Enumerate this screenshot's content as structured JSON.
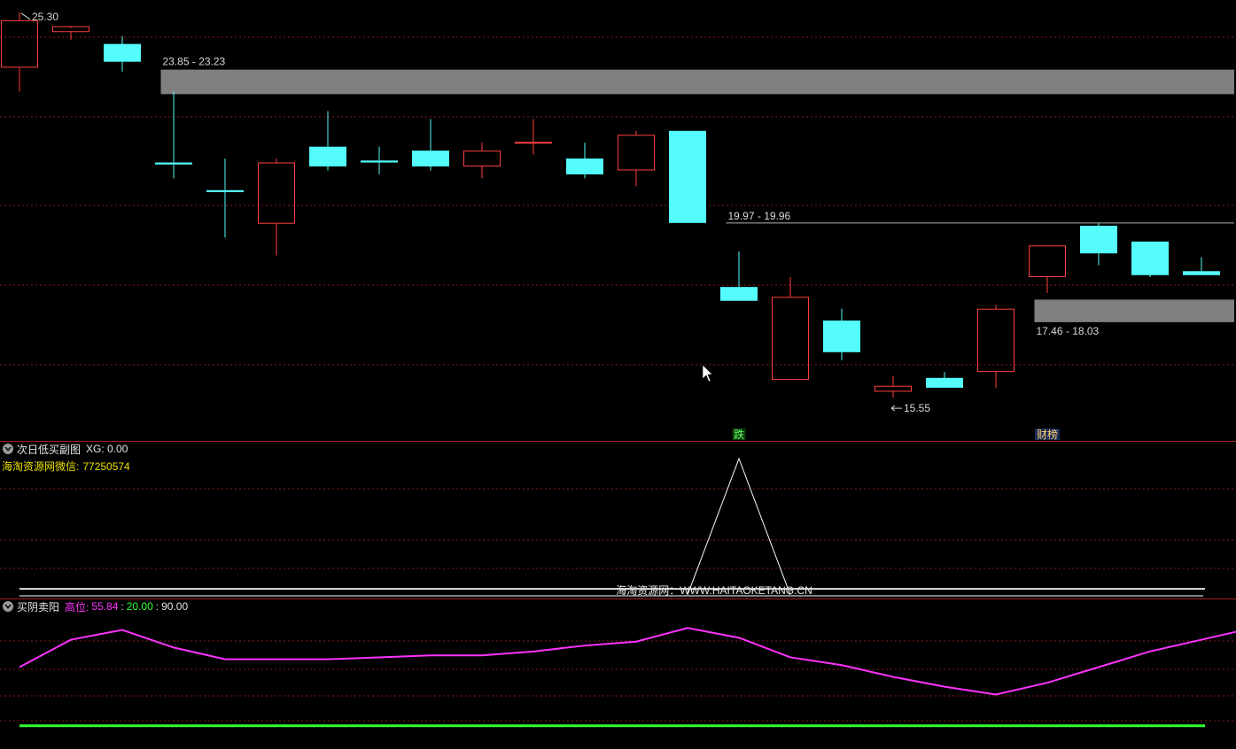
{
  "colors": {
    "up": "#ff4040",
    "down": "#54fcfc",
    "zone": "#808080",
    "grid": "#8b1a1a",
    "divider": "#a02020",
    "label": "#d8d8d8",
    "magenta": "#ff33ff",
    "green": "#33ff33",
    "signal": "#ffffff"
  },
  "pane1": {
    "title": "次日低买副图",
    "indicator": "XG",
    "value": "0.00",
    "wechat_label": "海淘资源网微信:",
    "wechat_id": "77250574",
    "watermark": "海淘资源网：WWW.HAITAOKETANG.CN"
  },
  "pane2": {
    "title": "买阴卖阳",
    "high_label": "高位:",
    "v1": "55.84",
    "v2": "20.00",
    "v3": "90.00"
  },
  "chart_data": [
    {
      "type": "candlestick",
      "price_range": [
        14.5,
        25.5
      ],
      "candles": [
        {
          "o": 23.9,
          "h": 25.3,
          "l": 23.3,
          "c": 25.1
        },
        {
          "o": 24.8,
          "h": 24.9,
          "l": 24.6,
          "c": 24.95
        },
        {
          "o": 24.5,
          "h": 24.7,
          "l": 23.8,
          "c": 24.05
        },
        {
          "o": 21.5,
          "h": 23.3,
          "l": 21.1,
          "c": 21.45
        },
        {
          "o": 20.8,
          "h": 21.6,
          "l": 19.6,
          "c": 20.75
        },
        {
          "o": 19.95,
          "h": 21.6,
          "l": 19.15,
          "c": 21.5
        },
        {
          "o": 21.9,
          "h": 22.8,
          "l": 21.3,
          "c": 21.4
        },
        {
          "o": 21.55,
          "h": 21.9,
          "l": 21.2,
          "c": 21.5
        },
        {
          "o": 21.8,
          "h": 22.6,
          "l": 21.3,
          "c": 21.4
        },
        {
          "o": 21.4,
          "h": 22.0,
          "l": 21.1,
          "c": 21.8
        },
        {
          "o": 22.0,
          "h": 22.6,
          "l": 21.7,
          "c": 22.0
        },
        {
          "o": 21.6,
          "h": 22.0,
          "l": 21.1,
          "c": 21.2
        },
        {
          "o": 21.3,
          "h": 22.3,
          "l": 20.9,
          "c": 22.2
        },
        {
          "o": 22.3,
          "h": 22.3,
          "l": 19.97,
          "c": 19.97
        },
        {
          "o": 18.35,
          "h": 19.25,
          "l": 18.0,
          "c": 18.0
        },
        {
          "o": 16.0,
          "h": 18.6,
          "l": 16.0,
          "c": 18.1
        },
        {
          "o": 17.5,
          "h": 17.8,
          "l": 16.5,
          "c": 16.7
        },
        {
          "o": 15.7,
          "h": 16.1,
          "l": 15.55,
          "c": 15.85
        },
        {
          "o": 16.05,
          "h": 16.2,
          "l": 15.8,
          "c": 15.8
        },
        {
          "o": 16.2,
          "h": 17.9,
          "l": 15.8,
          "c": 17.8
        },
        {
          "o": 18.6,
          "h": 19.4,
          "l": 18.2,
          "c": 19.4
        },
        {
          "o": 19.9,
          "h": 19.97,
          "l": 18.9,
          "c": 19.2
        },
        {
          "o": 19.5,
          "h": 19.5,
          "l": 18.6,
          "c": 18.65
        },
        {
          "o": 18.75,
          "h": 19.1,
          "l": 18.65,
          "c": 18.65
        }
      ],
      "zones": [
        {
          "from_index": 2.75,
          "low": 23.23,
          "high": 23.85,
          "label": "23.85 - 23.23"
        },
        {
          "from_index": 13.75,
          "low": 19.96,
          "high": 19.97,
          "label": "19.97 - 19.96"
        },
        {
          "from_index": 19.75,
          "low": 17.46,
          "high": 18.03,
          "label": "17.46 - 18.03"
        }
      ],
      "annotations": [
        {
          "index": 0,
          "price": 25.3,
          "text": "25.30",
          "kind": "high"
        },
        {
          "index": 17,
          "price": 15.55,
          "text": "15.55",
          "kind": "low"
        },
        {
          "index": 14,
          "text": "跌",
          "kind": "tag-green"
        },
        {
          "index": 20,
          "text": "财榜",
          "kind": "tag-blue"
        }
      ]
    },
    {
      "type": "line",
      "name": "XG",
      "y_range": [
        0,
        1
      ],
      "signal": {
        "index": 14,
        "value": 1
      }
    },
    {
      "type": "line",
      "y_range": [
        0,
        100
      ],
      "series": [
        {
          "role": "main",
          "values": [
            50,
            64,
            69,
            60,
            54,
            54,
            54,
            55,
            56,
            56,
            58,
            61,
            63,
            70,
            65,
            55,
            51,
            45,
            40,
            36,
            42,
            50,
            58,
            64,
            70
          ]
        },
        {
          "role": "upper",
          "values": [
            90
          ]
        },
        {
          "role": "lower",
          "values": [
            20
          ]
        }
      ]
    }
  ]
}
